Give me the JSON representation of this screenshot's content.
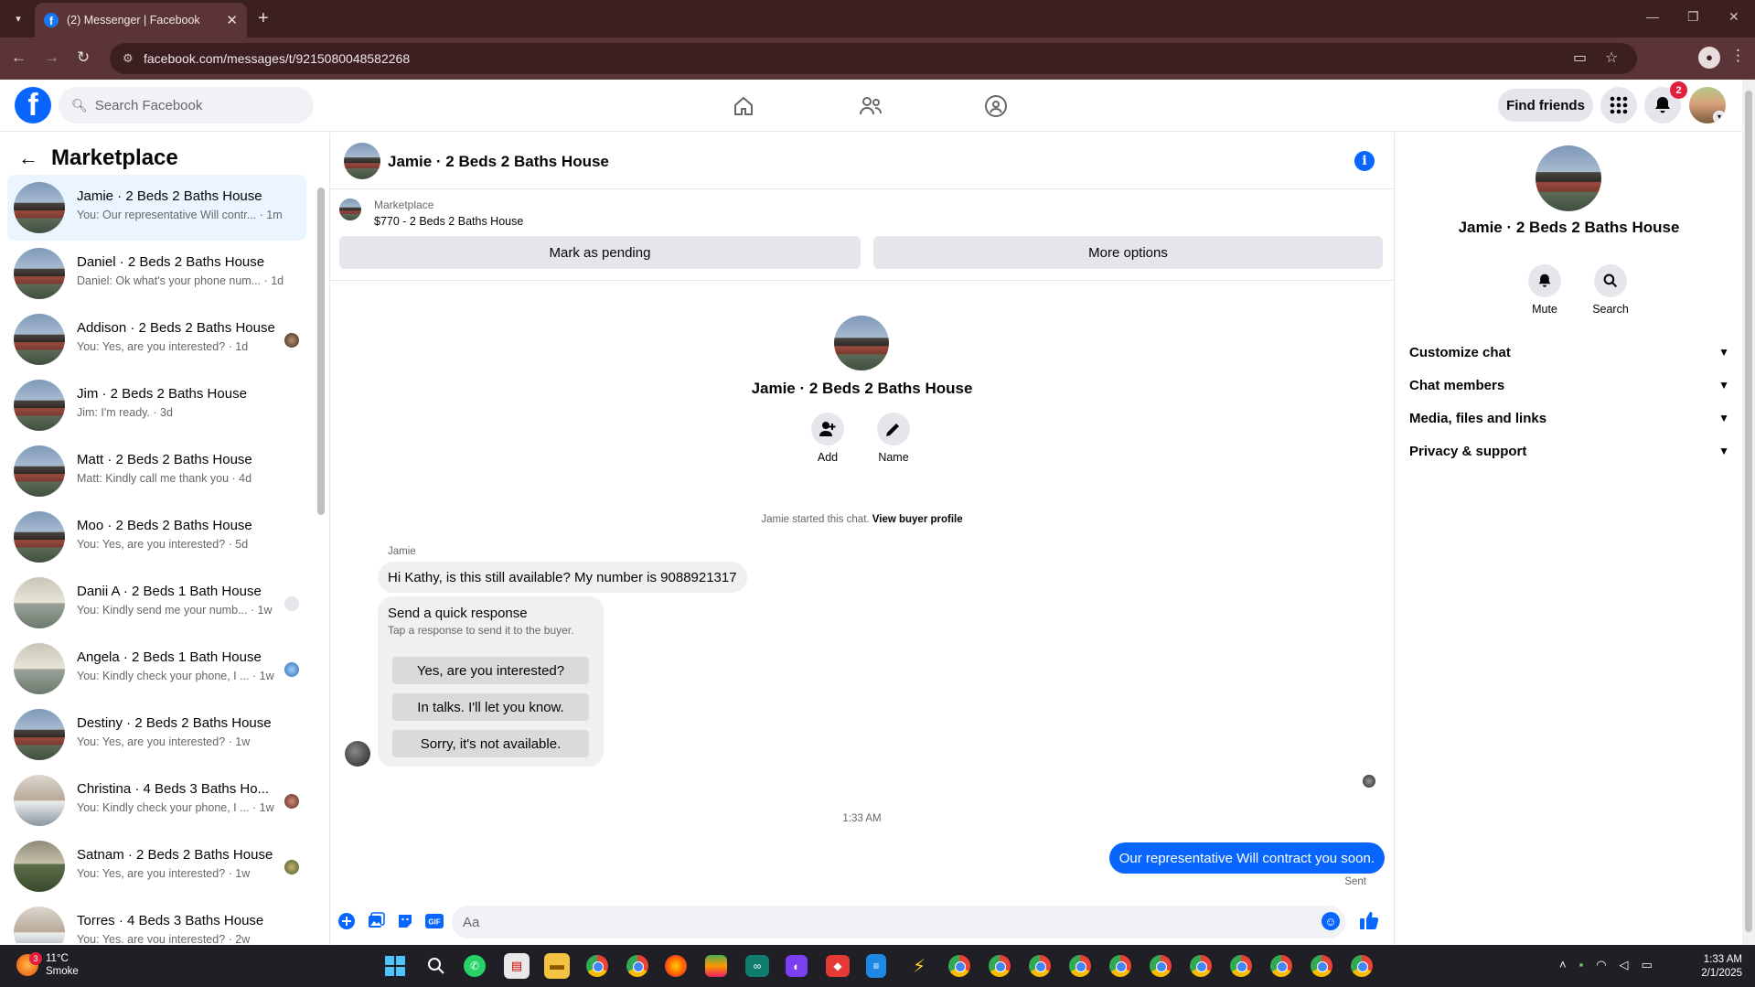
{
  "browser": {
    "tab_title": "(2) Messenger | Facebook",
    "url": "facebook.com/messages/t/9215080048582268"
  },
  "header": {
    "search_placeholder": "Search Facebook",
    "find_friends": "Find friends",
    "notification_count": "2"
  },
  "sidebar": {
    "title": "Marketplace",
    "conversations": [
      {
        "name": "Jamie · 2 Beds 2 Baths House",
        "preview": "You: Our representative Will contr... · 1m",
        "active": true
      },
      {
        "name": "Daniel · 2 Beds 2 Baths House",
        "preview": "Daniel: Ok what's your phone num... · 1d"
      },
      {
        "name": "Addison · 2 Beds 2 Baths House",
        "preview": "You: Yes, are you interested? · 1d"
      },
      {
        "name": "Jim · 2 Beds 2 Baths House",
        "preview": "Jim: I'm ready. · 3d"
      },
      {
        "name": "Matt · 2 Beds 2 Baths House",
        "preview": "Matt: Kindly call me thank you · 4d"
      },
      {
        "name": "Moo · 2 Beds 2 Baths House",
        "preview": "You: Yes, are you interested? · 5d"
      },
      {
        "name": "Danii A · 2 Beds 1 Bath House",
        "preview": "You: Kindly send me your numb... · 1w"
      },
      {
        "name": "Angela · 2 Beds 1 Bath House",
        "preview": "You: Kindly check your phone, I ... · 1w"
      },
      {
        "name": "Destiny · 2 Beds 2 Baths House",
        "preview": "You: Yes, are you interested? · 1w"
      },
      {
        "name": "Christina · 4 Beds 3 Baths Ho...",
        "preview": "You: Kindly check your phone, I ... · 1w"
      },
      {
        "name": "Satnam · 2 Beds 2 Baths House",
        "preview": "You: Yes, are you interested? · 1w"
      },
      {
        "name": "Torres · 4 Beds 3 Baths House",
        "preview": "You: Yes, are you interested? · 2w"
      }
    ]
  },
  "chat": {
    "title": "Jamie · 2 Beds 2 Baths House",
    "marketplace_label": "Marketplace",
    "listing": "$770 - 2 Beds 2 Baths House",
    "mark_pending": "Mark as pending",
    "more_options": "More options",
    "add_label": "Add",
    "name_label": "Name",
    "started_text": "Jamie started this chat.",
    "view_buyer": "View buyer profile",
    "sender_name": "Jamie",
    "incoming_message": "Hi Kathy, is this still available? My number is 9088921317",
    "quick_title": "Send a quick response",
    "quick_subtitle": "Tap a response to send it to the buyer.",
    "quick_responses": [
      "Yes, are you interested?",
      "In talks. I'll let you know.",
      "Sorry, it's not available."
    ],
    "timestamp": "1:33 AM",
    "outgoing_message": "Our representative Will contract you soon.",
    "sent_label": "Sent",
    "composer_placeholder": "Aa"
  },
  "details": {
    "name": "Jamie · 2 Beds 2 Baths House",
    "mute": "Mute",
    "search": "Search",
    "sections": [
      "Customize chat",
      "Chat members",
      "Media, files and links",
      "Privacy & support"
    ]
  },
  "taskbar": {
    "temp": "11°C",
    "condition": "Smoke",
    "weather_badge": "3",
    "time": "1:33 AM",
    "date": "2/1/2025"
  }
}
